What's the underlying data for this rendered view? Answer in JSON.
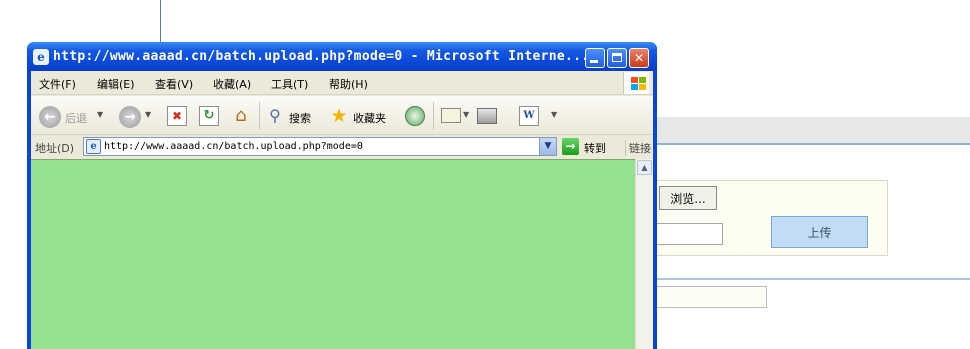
{
  "background_page": {
    "browse_button": "浏览...",
    "upload_button": "上传"
  },
  "window": {
    "title": "http://www.aaaad.cn/batch.upload.php?mode=0 - Microsoft Interne...",
    "controls": {
      "minimize": "_",
      "maximize": "□",
      "close": "✕"
    },
    "menu": [
      "文件(F)",
      "编辑(E)",
      "查看(V)",
      "收藏(A)",
      "工具(T)",
      "帮助(H)"
    ],
    "toolbar": {
      "back_label": "后退",
      "search_label": "搜索",
      "favorites_label": "收藏夹"
    },
    "address": {
      "label": "地址(D)",
      "url": "http://www.aaaad.cn/batch.upload.php?mode=0",
      "go_label": "转到",
      "links_label": "链接"
    },
    "content_color": "#94e28f"
  }
}
